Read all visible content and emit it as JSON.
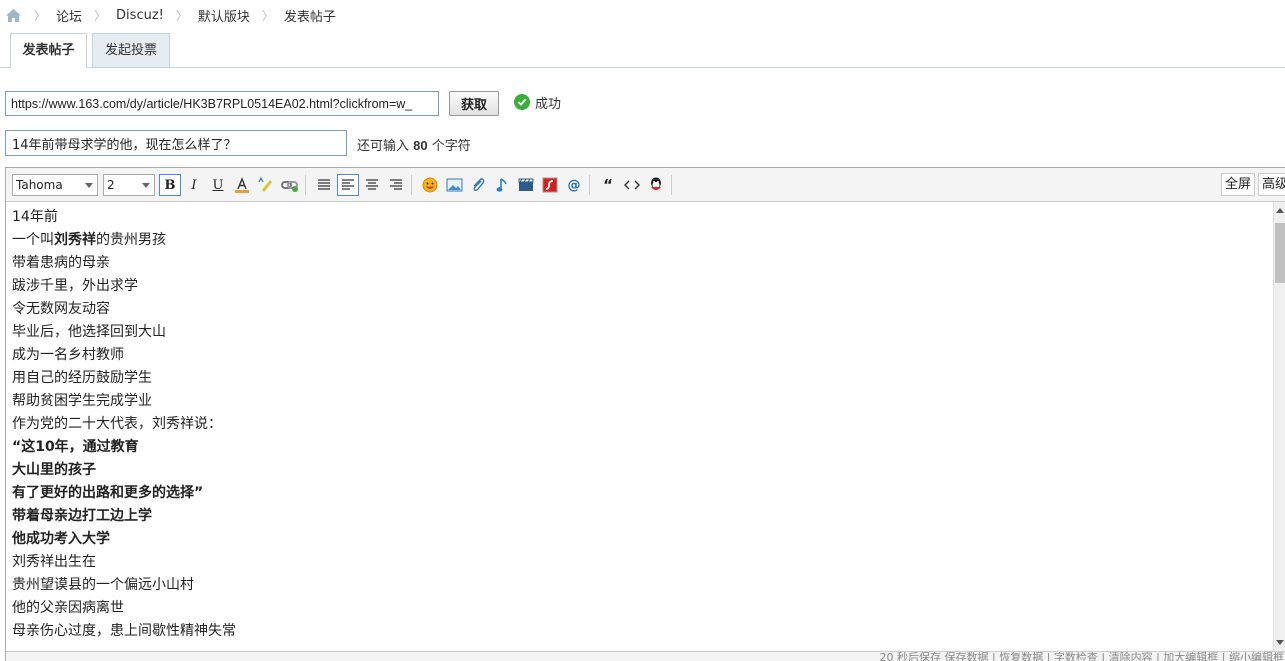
{
  "breadcrumb": {
    "items": [
      "论坛",
      "Discuz!",
      "默认版块",
      "发表帖子"
    ]
  },
  "tabs": [
    {
      "label": "发表帖子",
      "active": true
    },
    {
      "label": "发起投票",
      "active": false
    }
  ],
  "fetch": {
    "url_value": "https://www.163.com/dy/article/HK3B7RPL0514EA02.html?clickfrom=w_",
    "button_label": "获取",
    "status_text": "成功"
  },
  "post": {
    "title_value": "14年前带母求学的他，现在怎么样了？",
    "remain_prefix": "还可输入",
    "remain_count": "80",
    "remain_suffix": "个字符"
  },
  "toolbar": {
    "font_family": "Tahoma",
    "font_size": "2",
    "bold": "B",
    "italic": "I",
    "underline": "U",
    "fullscreen_label": "全屏",
    "advanced_label": "高级"
  },
  "editor": {
    "lines": [
      {
        "text": "14年前",
        "bold": false
      },
      {
        "segments": [
          "一个叫",
          "刘秀祥",
          "的贵州男孩"
        ]
      },
      {
        "text": "带着患病的母亲",
        "bold": false
      },
      {
        "text": "跋涉千里，外出求学",
        "bold": false
      },
      {
        "text": "令无数网友动容",
        "bold": false
      },
      {
        "text": "毕业后，他选择回到大山",
        "bold": false
      },
      {
        "text": "成为一名乡村教师",
        "bold": false
      },
      {
        "text": "用自己的经历鼓励学生",
        "bold": false
      },
      {
        "text": "帮助贫困学生完成学业",
        "bold": false
      },
      {
        "text": "作为党的二十大代表，刘秀祥说：",
        "bold": false
      },
      {
        "text": "“这10年，通过教育",
        "bold": true
      },
      {
        "text": "大山里的孩子",
        "bold": true
      },
      {
        "text": "有了更好的出路和更多的选择”",
        "bold": true
      },
      {
        "text": "带着母亲边打工边上学",
        "bold": true
      },
      {
        "text": "他成功考入大学",
        "bold": true
      },
      {
        "text": "刘秀祥出生在",
        "bold": false
      },
      {
        "text": "贵州望谟县的一个偏远小山村",
        "bold": false
      },
      {
        "text": "他的父亲因病离世",
        "bold": false
      },
      {
        "text": "母亲伤心过度，患上间歇性精神失常",
        "bold": false
      }
    ]
  },
  "status_bar": {
    "text": "20 秒后保存 保存数据 | 恢复数据 | 字数检查 | 清除内容 | 加大编辑框 | 缩小编辑框"
  },
  "colors": {
    "tab_border": "#c2d5e3",
    "tab_inactive_bg": "#e5edf2",
    "success_green": "#3cae3c",
    "toolbar_highlight": "#4a8bd1"
  }
}
